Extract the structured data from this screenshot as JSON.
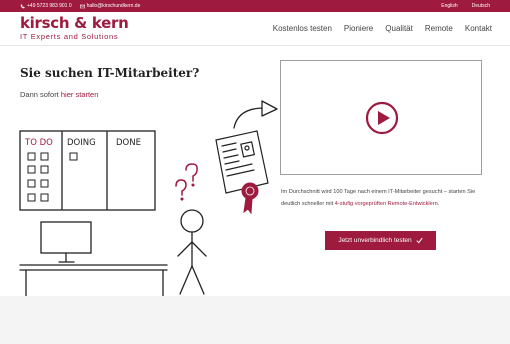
{
  "topbar": {
    "phone": "+49 5723 983 901 0",
    "email": "hallo@kirschundkern.de",
    "lang_en": "English",
    "lang_de": "Deutsch"
  },
  "brand": {
    "name": "kirsch & kern",
    "tagline": "IT Experts and Solutions",
    "color": "#9e1b3f"
  },
  "nav": {
    "items": [
      "Kostenlos testen",
      "Pioniere",
      "Qualität",
      "Remote",
      "Kontakt"
    ]
  },
  "hero": {
    "title": "Sie suchen IT-Mitarbeiter?",
    "sub_prefix": "Dann sofort ",
    "sub_link": "hier starten"
  },
  "board": {
    "col1": "TO DO",
    "col2": "DOING",
    "col3": "DONE"
  },
  "description": {
    "part1": "Im Durchschnitt wird 100 Tage nach einem IT-Mitarbeiter gesucht – starten Sie deutlich schneller mit ",
    "link": "4-stufig vorgeprüften Remote-Entwicklern",
    "part2": "."
  },
  "cta": {
    "label": "Jetzt unverbindlich testen",
    "icon": "check-icon"
  },
  "icons": {
    "phone": "phone-icon",
    "mail": "mail-icon",
    "play": "play-icon"
  }
}
